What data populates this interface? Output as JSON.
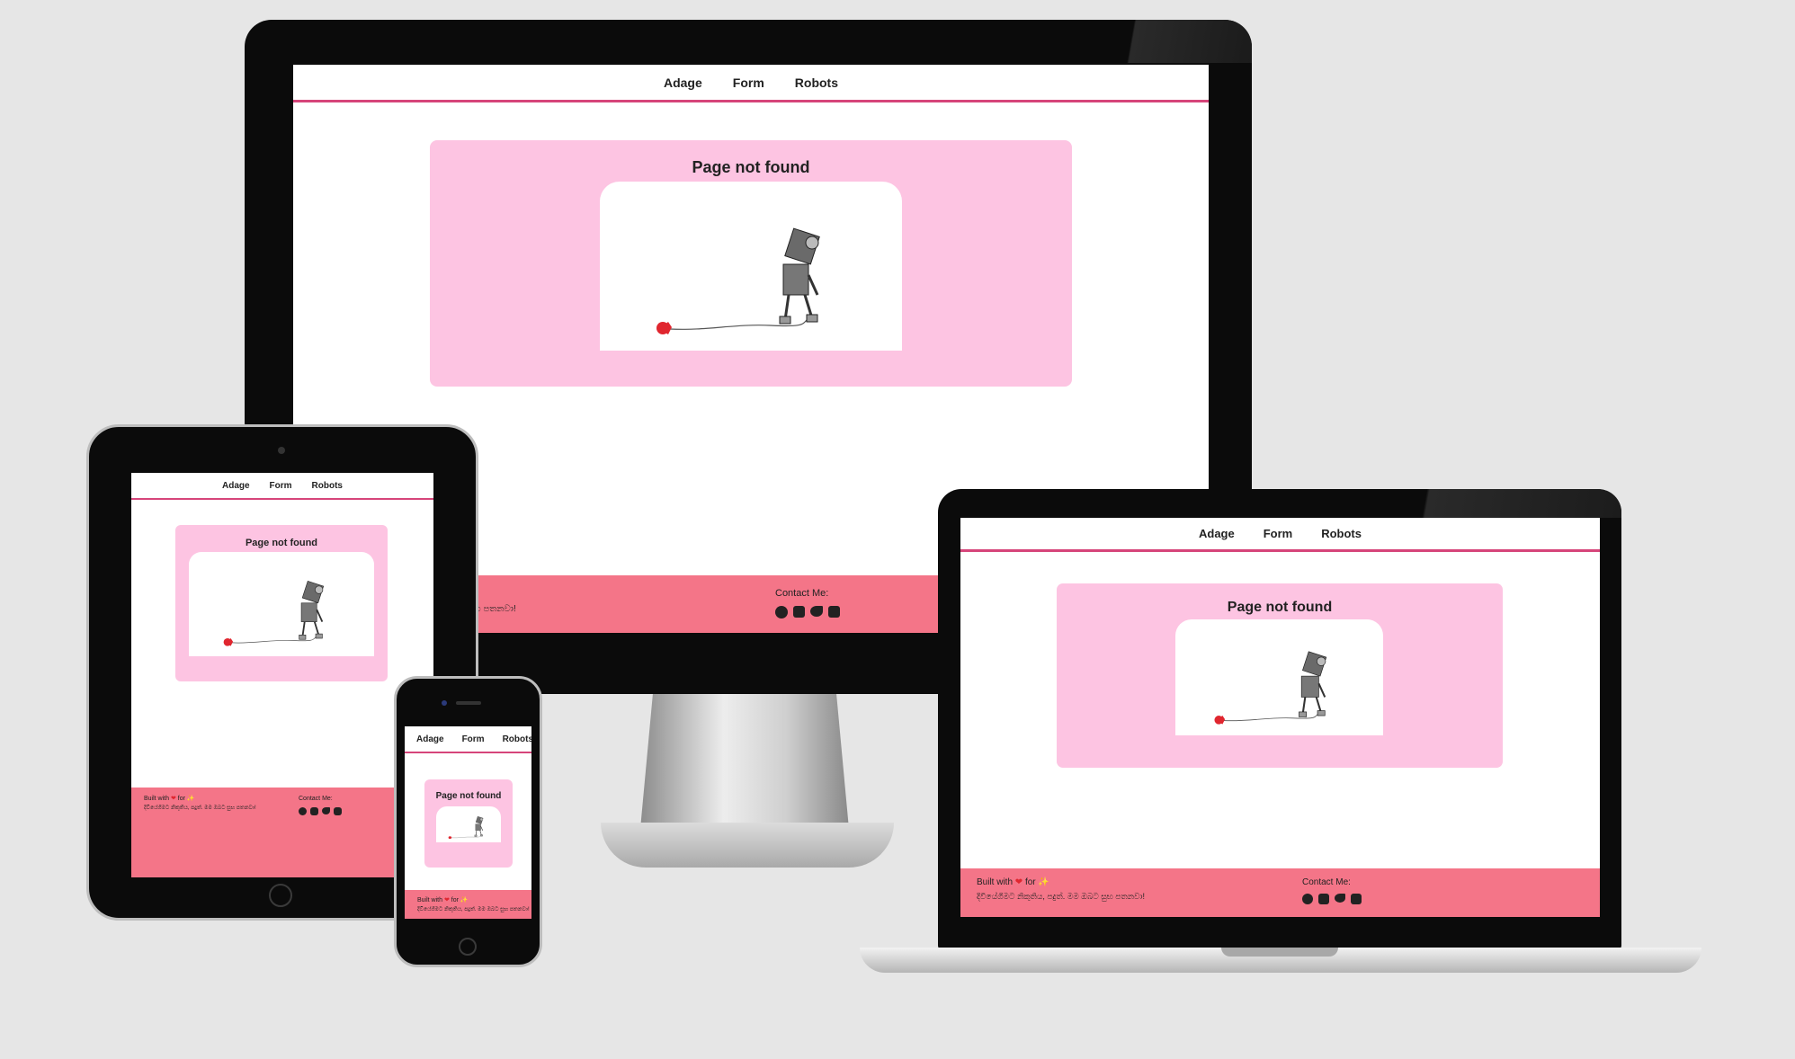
{
  "nav": {
    "items": [
      "Adage",
      "Form",
      "Robots"
    ]
  },
  "main": {
    "title": "Page not found"
  },
  "footer": {
    "built_prefix": "Built with ",
    "built_mid": " for ",
    "tagline": "දිවියේගිමට නිකුතිය, පදුත්. මම ඔබට සුභ පතනවා!",
    "contact_label": "Contact Me:",
    "icons": [
      "github-icon",
      "instagram-icon",
      "twitter-icon",
      "linkedin-icon"
    ]
  },
  "colors": {
    "background": "#e6e6e6",
    "nav_border": "#d6457a",
    "card": "#fdc4e2",
    "footer": "#f47588",
    "heart": "#e0262f"
  }
}
